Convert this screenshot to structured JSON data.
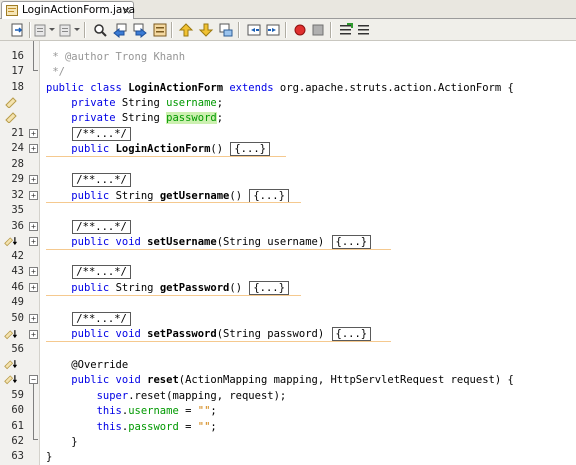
{
  "tab": {
    "title": "LoginActionForm.java",
    "close": "×"
  },
  "toolbar": {
    "items": [
      "last-edit-icon",
      "back-icon",
      "forward-icon",
      "find-selection-icon",
      "find-previous-icon",
      "find-next-icon",
      "toggle-highlight-icon",
      "previous-bookmark-icon",
      "next-bookmark-icon",
      "toggle-bookmark-icon",
      "shift-left-icon",
      "shift-right-icon",
      "record-macro-icon",
      "stop-macro-icon",
      "comment-icon",
      "uncomment-icon"
    ]
  },
  "code": {
    "lines": [
      {
        "num": "16",
        "text": " * @author Trong Khanh"
      },
      {
        "num": "17",
        "text": " */"
      },
      {
        "num": "18",
        "kw1": "public class ",
        "name": "LoginActionForm",
        "kw2": " extends ",
        "rest": "org.apache.struts.action.ActionForm {"
      },
      {
        "num": "",
        "kw": "private ",
        "type": "String ",
        "field": "username",
        "end": ";"
      },
      {
        "num": "",
        "kw": "private ",
        "type": "String ",
        "field": "password",
        "end": ";"
      },
      {
        "num": "21",
        "fold": "/**...*/"
      },
      {
        "num": "24",
        "kw": "public ",
        "name": "LoginActionForm",
        "sig": "() ",
        "fold": "{...}"
      },
      {
        "num": "28",
        "text": ""
      },
      {
        "num": "29",
        "fold": "/**...*/"
      },
      {
        "num": "32",
        "kw": "public ",
        "type": "String ",
        "name": "getUsername",
        "sig": "() ",
        "fold": "{...}"
      },
      {
        "num": "35",
        "text": ""
      },
      {
        "num": "36",
        "fold": "/**...*/"
      },
      {
        "num": "",
        "kw": "public void ",
        "name": "setUsername",
        "sig": "(String username) ",
        "fold": "{...}"
      },
      {
        "num": "42",
        "text": ""
      },
      {
        "num": "43",
        "fold": "/**...*/"
      },
      {
        "num": "46",
        "kw": "public ",
        "type": "String ",
        "name": "getPassword",
        "sig": "() ",
        "fold": "{...}"
      },
      {
        "num": "49",
        "text": ""
      },
      {
        "num": "50",
        "fold": "/**...*/"
      },
      {
        "num": "",
        "kw": "public void ",
        "name": "setPassword",
        "sig": "(String password) ",
        "fold": "{...}"
      },
      {
        "num": "56",
        "text": ""
      },
      {
        "num": "",
        "annotation": "@Override"
      },
      {
        "num": "",
        "kw": "public void ",
        "name": "reset",
        "sig": "(ActionMapping mapping, HttpServletRequest request) {"
      },
      {
        "num": "59",
        "kw": "super",
        "rest": ".reset(mapping, request);"
      },
      {
        "num": "60",
        "kw": "this",
        "dot": ".",
        "field": "username",
        "eq": " = ",
        "str": "\"\"",
        "end": ";"
      },
      {
        "num": "61",
        "kw": "this",
        "dot": ".",
        "field": "password",
        "eq": " = ",
        "str": "\"\"",
        "end": ";"
      },
      {
        "num": "62",
        "text": "    }"
      },
      {
        "num": "63",
        "text": "}"
      }
    ]
  }
}
